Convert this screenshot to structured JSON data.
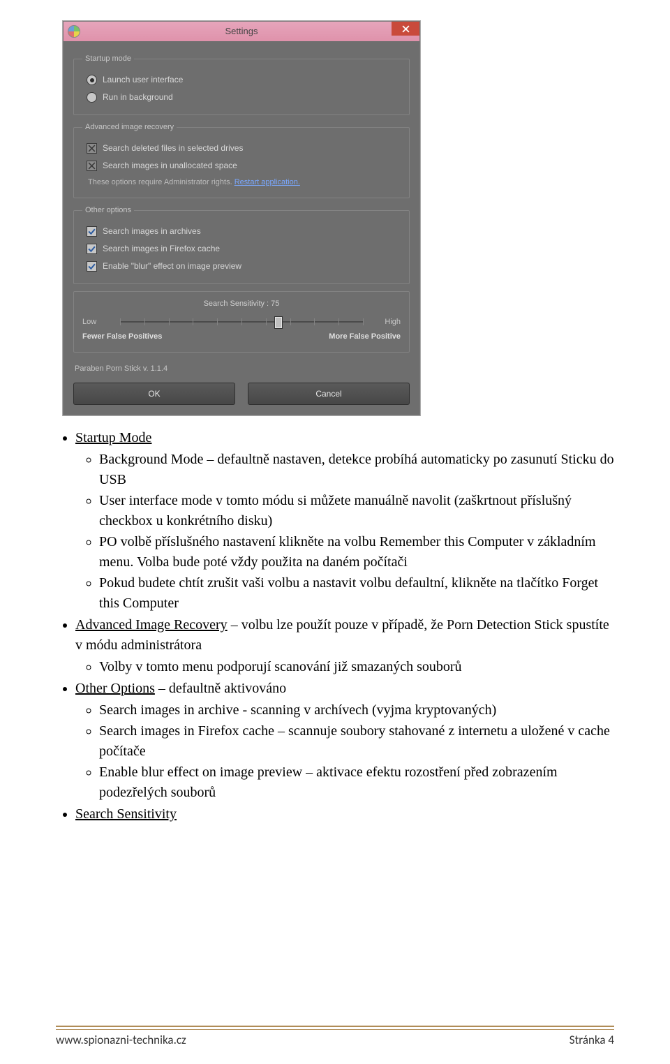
{
  "window": {
    "title": "Settings",
    "close_icon": "close",
    "groups": {
      "startup": {
        "legend": "Startup mode",
        "launch_label": "Launch user interface",
        "background_label": "Run in background"
      },
      "advanced": {
        "legend": "Advanced image recovery",
        "opt1": "Search deleted files in selected drives",
        "opt2": "Search images  in unallocated space",
        "note_prefix": "These options require Administrator rights.",
        "note_link": "Restart application."
      },
      "other": {
        "legend": "Other options",
        "opt1": "Search images  in archives",
        "opt2": "Search images  in Firefox cache",
        "opt3": "Enable \"blur\" effect on image preview"
      },
      "slider": {
        "title": "Search Sensitivity : 75",
        "low": "Low",
        "high": "High",
        "caption_low": "Fewer False Positives",
        "caption_high": "More False Positive",
        "value_pct": 65
      }
    },
    "version": "Paraben Porn Stick v. 1.1.4",
    "ok": "OK",
    "cancel": "Cancel"
  },
  "doc": {
    "b1": {
      "title": "Startup Mode"
    },
    "b1a": "Background Mode – defaultně nastaven, detekce probíhá automaticky po zasunutí Sticku do USB",
    "b1b": "User interface mode v tomto módu si můžete manuálně navolit (zaškrtnout příslušný checkbox u konkrétního disku)",
    "b1c": "PO volbě příslušného nastavení klikněte na volbu Remember this Computer v základním menu. Volba bude poté vždy použita na daném počítači",
    "b1d": "Pokud budete chtít zrušit vaši volbu a nastavit volbu defaultní, klikněte na tlačítko Forget this Computer",
    "b2": {
      "title": "Advanced Image Recovery",
      "rest": " – volbu lze použít pouze v případě, že Porn Detection Stick spustíte v módu administrátora"
    },
    "b2a": "Volby v tomto menu podporují scanování již smazaných souborů",
    "b3": {
      "title": "Other Options",
      "rest": " – defaultně aktivováno"
    },
    "b3a": "Search images in archive  - scanning v archívech (vyjma kryptovaných)",
    "b3b": "Search images in Firefox cache – scannuje soubory stahované z internetu a uložené v cache počítače",
    "b3c": "Enable blur effect on image preview – aktivace efektu rozostření před zobrazením podezřelých souborů",
    "b4": {
      "title": "Search Sensitivity"
    }
  },
  "footer": {
    "site": "www.spionazni-technika.cz",
    "page": "Stránka 4"
  }
}
